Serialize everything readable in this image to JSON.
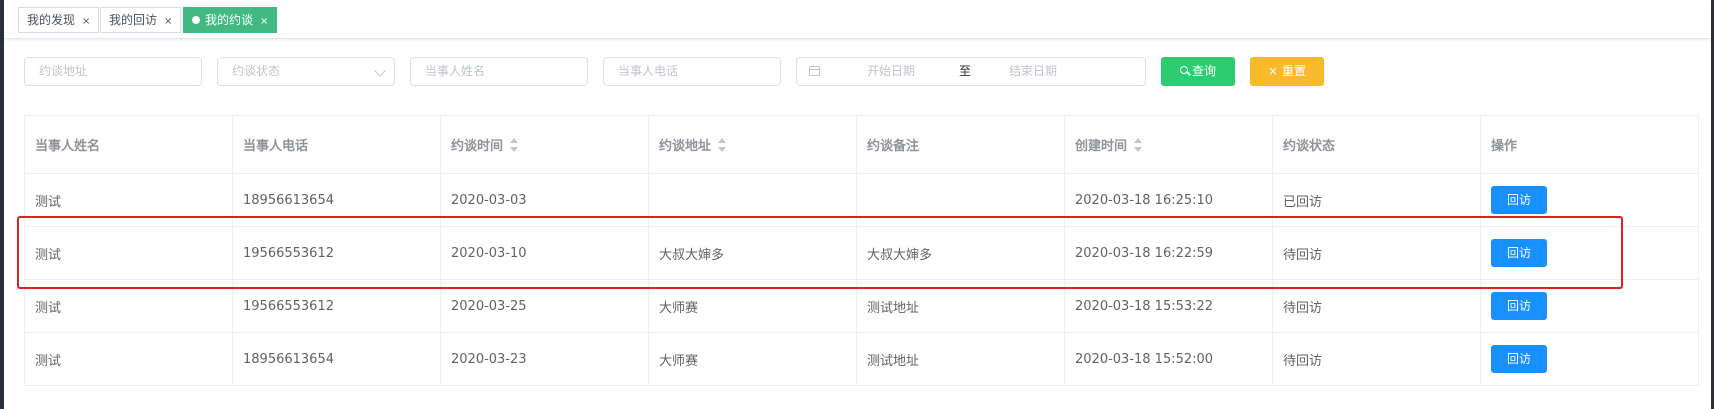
{
  "tags": [
    {
      "label": "我的发现",
      "close": "×",
      "active": false
    },
    {
      "label": "我的回访",
      "close": "×",
      "active": false
    },
    {
      "label": "我的约谈",
      "close": "×",
      "active": true
    }
  ],
  "filters": {
    "address_placeholder": "约谈地址",
    "status_placeholder": "约谈状态",
    "name_placeholder": "当事人姓名",
    "phone_placeholder": "当事人电话",
    "start_date_placeholder": "开始日期",
    "range_separator": "至",
    "end_date_placeholder": "结束日期",
    "search_label": "查询",
    "reset_label": "重置",
    "reset_icon": "×"
  },
  "table": {
    "columns": [
      "当事人姓名",
      "当事人电话",
      "约谈时间",
      "约谈地址",
      "约谈备注",
      "创建时间",
      "约谈状态",
      "操作"
    ],
    "sortable": [
      false,
      false,
      true,
      true,
      false,
      true,
      false,
      false
    ],
    "rows": [
      {
        "name": "测试",
        "phone": "18956613654",
        "time": "2020-03-03",
        "address": "",
        "note": "",
        "created": "2020-03-18 16:25:10",
        "status": "已回访",
        "action": "回访"
      },
      {
        "name": "测试",
        "phone": "19566553612",
        "time": "2020-03-10",
        "address": "大叔大婶多",
        "note": "大叔大婶多",
        "created": "2020-03-18 16:22:59",
        "status": "待回访",
        "action": "回访"
      },
      {
        "name": "测试",
        "phone": "19566553612",
        "time": "2020-03-25",
        "address": "大师赛",
        "note": "测试地址",
        "created": "2020-03-18 15:53:22",
        "status": "待回访",
        "action": "回访"
      },
      {
        "name": "测试",
        "phone": "18956613654",
        "time": "2020-03-23",
        "address": "大师赛",
        "note": "测试地址",
        "created": "2020-03-18 15:52:00",
        "status": "待回访",
        "action": "回访"
      }
    ]
  },
  "colors": {
    "active_tag": "#42b983",
    "search_button": "#2ecc71",
    "reset_button": "#f7ba2a",
    "action_button": "#1890ff",
    "highlight_box": "#e02020"
  }
}
